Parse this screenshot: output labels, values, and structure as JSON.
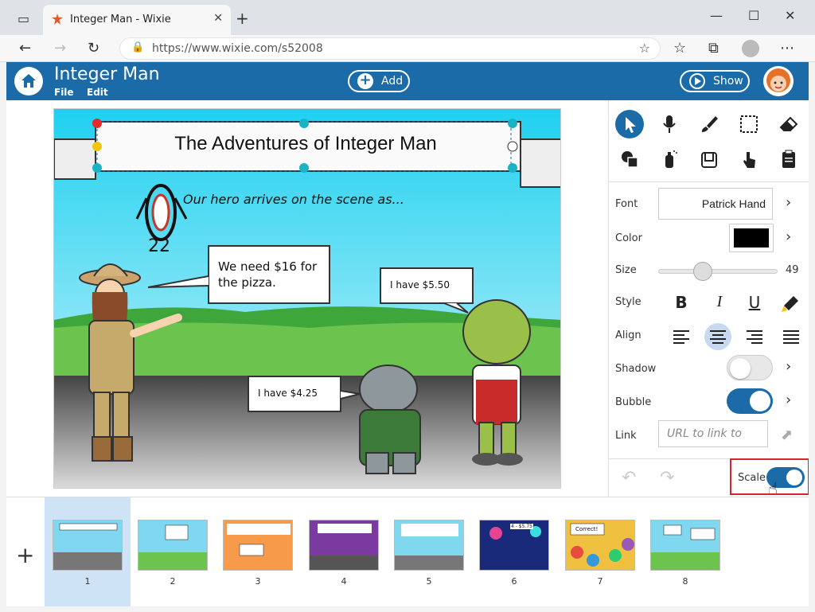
{
  "browser": {
    "tab_title": "Integer Man - Wixie",
    "url": "https://www.wixie.com/s52008"
  },
  "app": {
    "title": "Integer Man",
    "menu": {
      "file": "File",
      "edit": "Edit"
    },
    "add_label": "Add",
    "show_label": "Show"
  },
  "slide": {
    "title": "The Adventures of Integer Man",
    "caption": "Our hero arrives on the scene as...",
    "hero_number": "22",
    "bubble1": "We need $16 for the pizza.",
    "bubble2": "I have $5.50",
    "bubble3": "I have $4.25"
  },
  "panel": {
    "font_label": "Font",
    "font_value": "Patrick Hand",
    "color_label": "Color",
    "color_value": "#000000",
    "size_label": "Size",
    "size_value": "49",
    "style_label": "Style",
    "bold": "B",
    "italic": "I",
    "underline": "U",
    "align_label": "Align",
    "shadow_label": "Shadow",
    "shadow_on": false,
    "bubble_label": "Bubble",
    "bubble_on": true,
    "link_label": "Link",
    "link_placeholder": "URL to link to",
    "scale_label": "Scale",
    "scale_on": true
  },
  "thumbs": [
    {
      "num": "1",
      "bg": "#7fd8f0"
    },
    {
      "num": "2",
      "bg": "#7fd8f0"
    },
    {
      "num": "3",
      "bg": "#f79a4a"
    },
    {
      "num": "4",
      "bg": "#7a3aa0"
    },
    {
      "num": "5",
      "bg": "#7fd8f0"
    },
    {
      "num": "6",
      "bg": "#1a2a7a"
    },
    {
      "num": "7",
      "bg": "#f0c040"
    },
    {
      "num": "8",
      "bg": "#7fd8f0"
    }
  ],
  "thumb_texts": {
    "t6": "4 - $5.75",
    "t7": "Correct!"
  },
  "colors": {
    "brand": "#1a6ba8",
    "highlight": "#d9232d"
  }
}
